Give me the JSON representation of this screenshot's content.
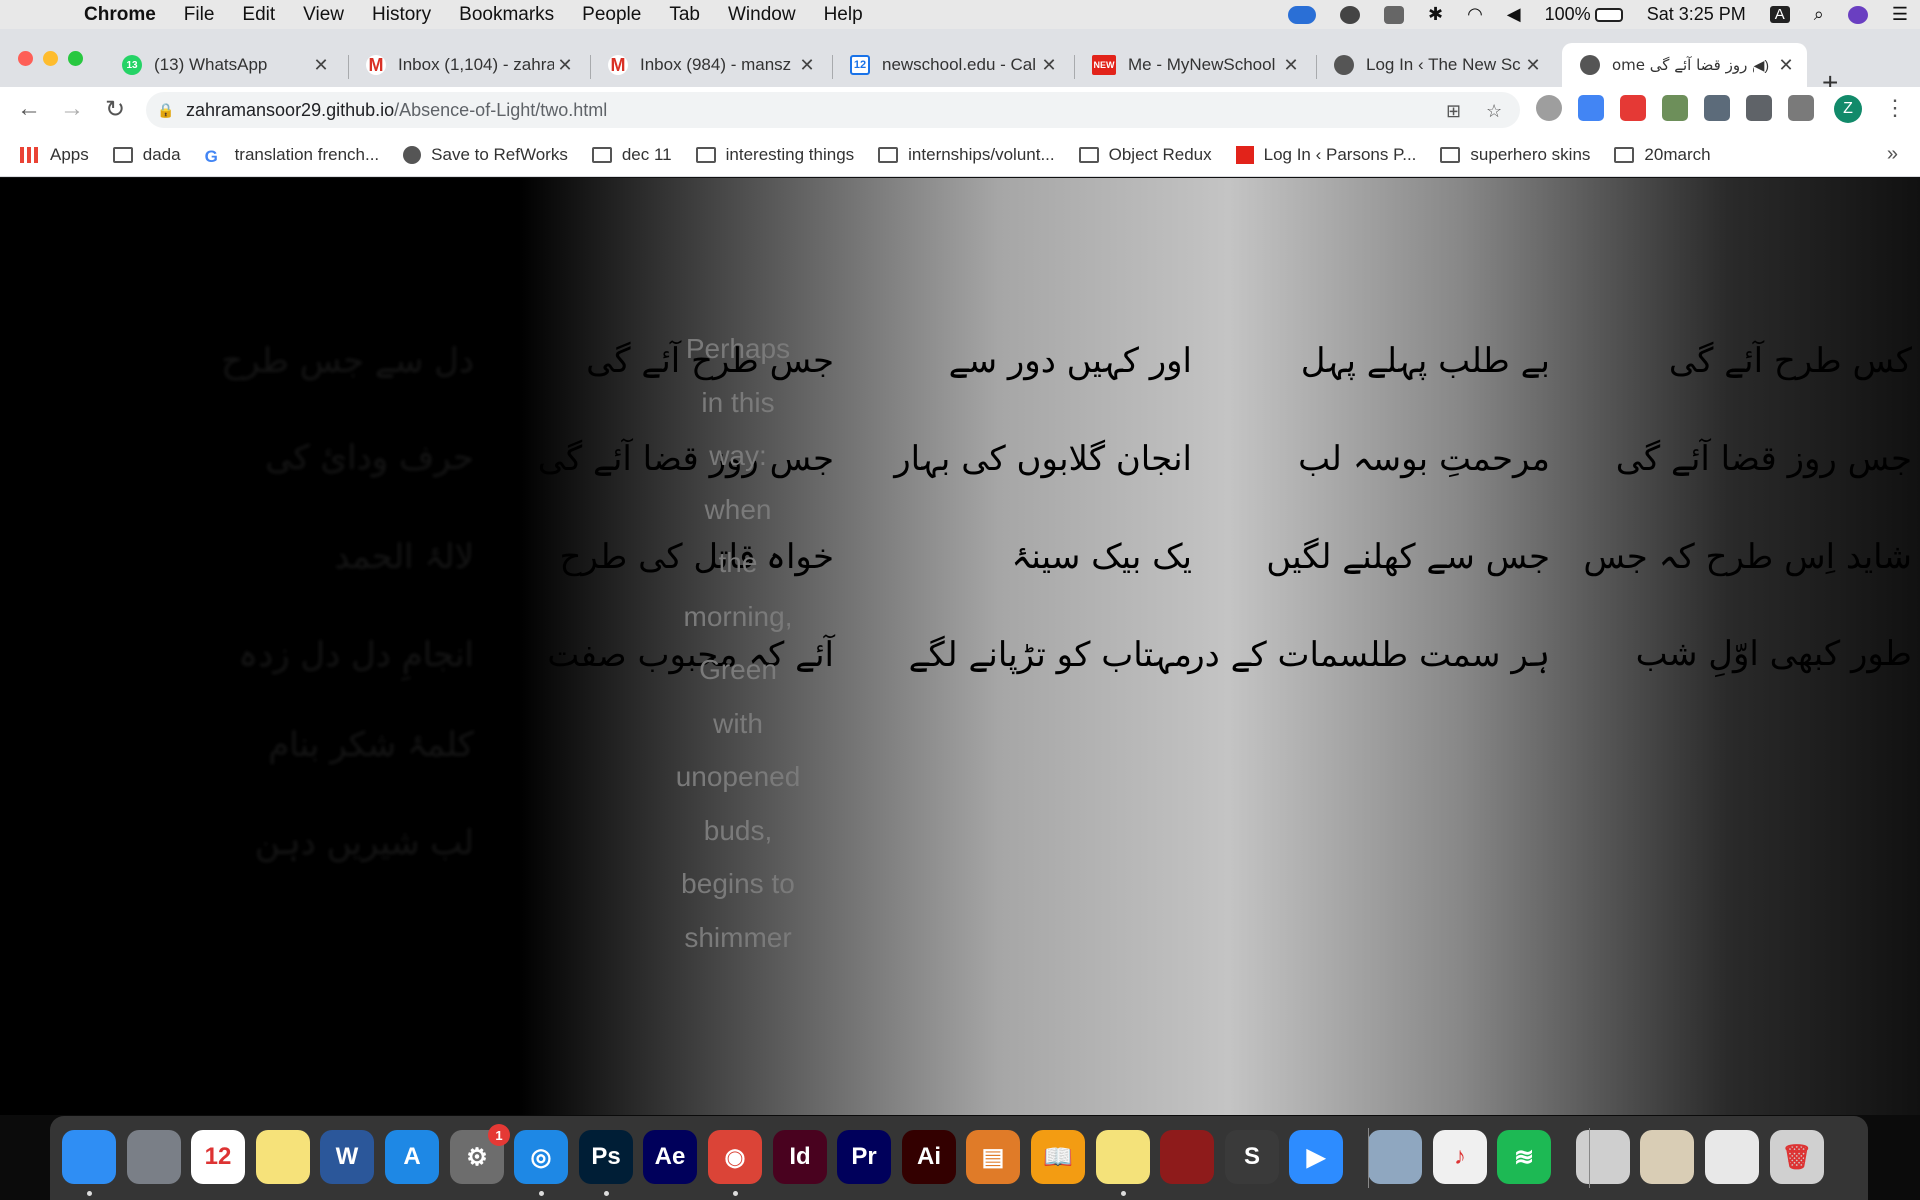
{
  "menubar": {
    "app_name": "Chrome",
    "items": [
      "File",
      "Edit",
      "View",
      "History",
      "Bookmarks",
      "People",
      "Tab",
      "Window",
      "Help"
    ],
    "battery": "100%",
    "clock": "Sat 3:25 PM",
    "input_source": "A"
  },
  "tabs": [
    {
      "title": "(13) WhatsApp",
      "icon": "whatsapp-icon",
      "badge": "13"
    },
    {
      "title": "Inbox (1,104) - zahra",
      "icon": "gmail-icon"
    },
    {
      "title": "Inbox (984) - mansz",
      "icon": "gmail-icon"
    },
    {
      "title": "newschool.edu - Cal",
      "icon": "calendar-icon",
      "badge": "12"
    },
    {
      "title": "Me - MyNewSchool",
      "icon": "newschool-icon",
      "badge": "NEW"
    },
    {
      "title": "Log In ‹ The New Sc",
      "icon": "globe-icon"
    },
    {
      "title": "ome جس روز قضا آئے گی",
      "icon": "globe-icon",
      "active": true
    }
  ],
  "address": {
    "host": "zahramansoor29.github.io",
    "path": "/Absence-of-Light/two.html"
  },
  "profile_initial": "Z",
  "bookmarks": [
    {
      "label": "Apps",
      "icon": "apps-grid-icon"
    },
    {
      "label": "dada",
      "icon": "folder-icon"
    },
    {
      "label": "translation french...",
      "icon": "google-icon"
    },
    {
      "label": "Save to RefWorks",
      "icon": "globe-icon"
    },
    {
      "label": "dec 11",
      "icon": "folder-icon"
    },
    {
      "label": "interesting things",
      "icon": "folder-icon"
    },
    {
      "label": "internships/volunt...",
      "icon": "folder-icon"
    },
    {
      "label": "Object Redux",
      "icon": "folder-icon"
    },
    {
      "label": "Log In ‹ Parsons P...",
      "icon": "newschool-icon"
    },
    {
      "label": "superhero skins",
      "icon": "folder-icon"
    },
    {
      "label": "20march",
      "icon": "folder-icon"
    }
  ],
  "page": {
    "columns": [
      {
        "lines": [
          "دل سے جس طرح",
          "حرف ودائ کی",
          "لالۂ الحمد",
          "انجامِ دل دل زدہ",
          "کلمۂ شکر بنام",
          "لب شیریں دہن"
        ],
        "faint": true
      },
      {
        "lines": [
          "جس طرح آئے گی",
          "جس روز قضا آئے گی",
          "خواہ قاتل کی طرح",
          "آئے کہ محبوب صفت"
        ]
      },
      {
        "lines": [
          "اور کہیں دور سے",
          "انجان گلابوں کی بہار",
          "یک بیک سینۂ",
          "مہتاب کو تڑپانے لگے"
        ]
      },
      {
        "lines": [
          "بے طلب پہلے پہل",
          "مرحمتِ بوسہ لب",
          "جس سے کھلنے لگیں",
          "ہر سمت طلسمات کے در"
        ]
      },
      {
        "lines": [
          "کس طرح آئے گی",
          "جس روز قضا آئے گی",
          "شاید اِس طرح کہ جس",
          "طور کبھی اوّلِ شب"
        ]
      }
    ],
    "english_lines": [
      "Perhaps",
      "in this",
      "way:",
      "when",
      "the",
      "morning,",
      "Green",
      "with",
      "unopened",
      "buds,",
      "begins to",
      "shimmer"
    ]
  },
  "dock": [
    {
      "name": "finder",
      "label": "",
      "color": "#2f8ef4",
      "running": true
    },
    {
      "name": "launchpad",
      "label": "",
      "color": "#7a7f87"
    },
    {
      "name": "calendar",
      "label": "12",
      "color": "#ffffff"
    },
    {
      "name": "notes",
      "label": "",
      "color": "#f6e27a"
    },
    {
      "name": "word",
      "label": "W",
      "color": "#2b579a"
    },
    {
      "name": "app-store",
      "label": "A",
      "color": "#1e88e5"
    },
    {
      "name": "system-preferences",
      "label": "⚙",
      "color": "#6d6d6d",
      "badge": "1"
    },
    {
      "name": "safari",
      "label": "◎",
      "color": "#1e88e5",
      "running": true
    },
    {
      "name": "photoshop",
      "label": "Ps",
      "color": "#001e36",
      "running": true
    },
    {
      "name": "after-effects",
      "label": "Ae",
      "color": "#00005b"
    },
    {
      "name": "chrome",
      "label": "◉",
      "color": "#db4437",
      "running": true
    },
    {
      "name": "indesign",
      "label": "Id",
      "color": "#49021f"
    },
    {
      "name": "premiere",
      "label": "Pr",
      "color": "#00005b"
    },
    {
      "name": "illustrator",
      "label": "Ai",
      "color": "#330000"
    },
    {
      "name": "slides-app",
      "label": "▤",
      "color": "#e07b28"
    },
    {
      "name": "books",
      "label": "📖",
      "color": "#f39c12"
    },
    {
      "name": "stickies",
      "label": "",
      "color": "#f4e27a",
      "running": true
    },
    {
      "name": "photo-booth",
      "label": "",
      "color": "#8e1b1b"
    },
    {
      "name": "sublime-text",
      "label": "S",
      "color": "#3a3a3a"
    },
    {
      "name": "zoom",
      "label": "▶",
      "color": "#2d8cff"
    },
    {
      "name": "preview",
      "label": "",
      "color": "#8fa7c0"
    },
    {
      "name": "music",
      "label": "♪",
      "color": "#f0f0f0"
    },
    {
      "name": "spotify",
      "label": "≋",
      "color": "#1db954"
    },
    {
      "name": "keyboard-doc",
      "label": "",
      "color": "#cfcfcf"
    },
    {
      "name": "document-stack",
      "label": "",
      "color": "#d9cdb5"
    },
    {
      "name": "screenshot-stack",
      "label": "",
      "color": "#e8e8e8"
    },
    {
      "name": "trash",
      "label": "🗑",
      "color": "#d0d0d0"
    }
  ]
}
